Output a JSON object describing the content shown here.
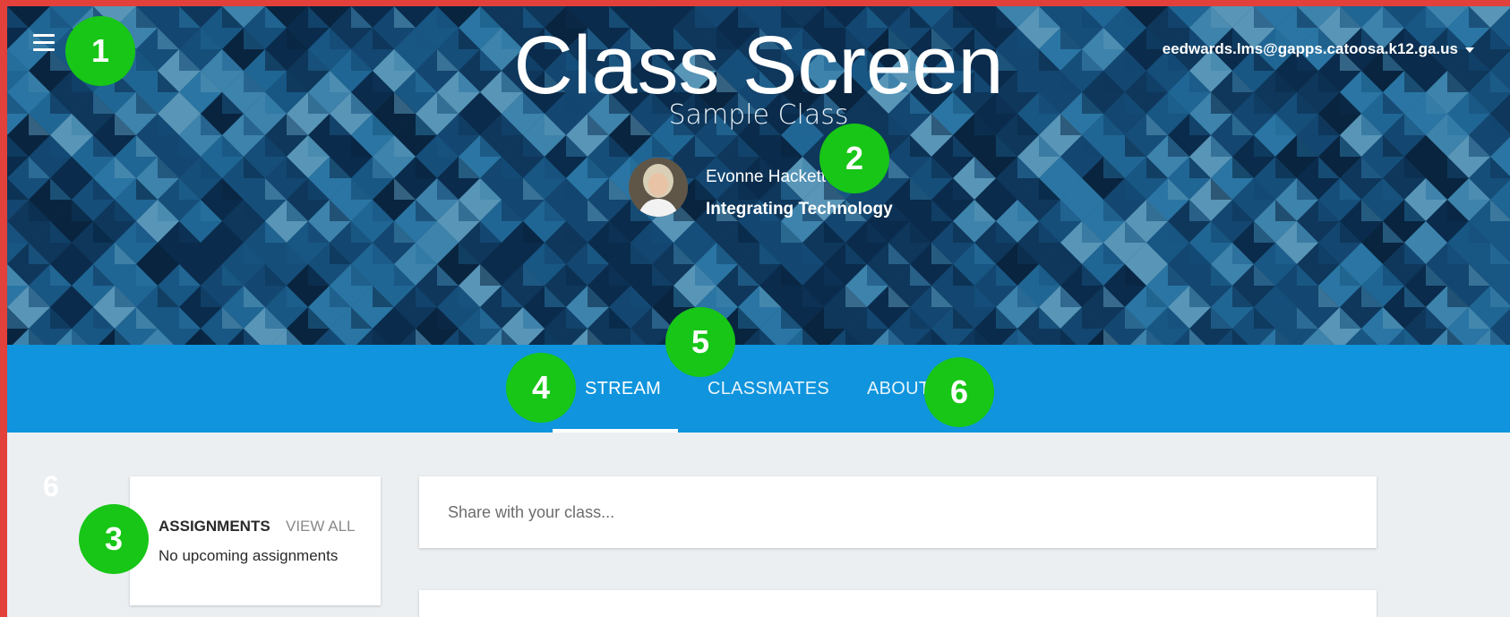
{
  "header": {
    "screen_title": "Class Screen",
    "class_name": "Sample Class",
    "account_email": "eedwards.lms@gapps.catoosa.k12.ga.us",
    "teacher_name": "Evonne Hackett",
    "course_name": "Integrating Technology",
    "menu_icon": "hamburger-menu-icon",
    "account_icon": "chevron-down-icon"
  },
  "tabs": [
    {
      "label": "STREAM",
      "active": true
    },
    {
      "label": "CLASSMATES",
      "active": false
    },
    {
      "label": "ABOUT",
      "active": false
    }
  ],
  "assignments": {
    "title": "ASSIGNMENTS",
    "view_all_label": "VIEW ALL",
    "empty_message": "No upcoming assignments"
  },
  "share": {
    "placeholder": "Share with your class..."
  },
  "callouts": [
    "1",
    "2",
    "3",
    "4",
    "5",
    "6"
  ],
  "stray_label": "6",
  "colors": {
    "frame_border": "#e2403a",
    "tabbar": "#0f94dd",
    "callout_badge": "#17c616",
    "page_background": "#ebeff2"
  }
}
